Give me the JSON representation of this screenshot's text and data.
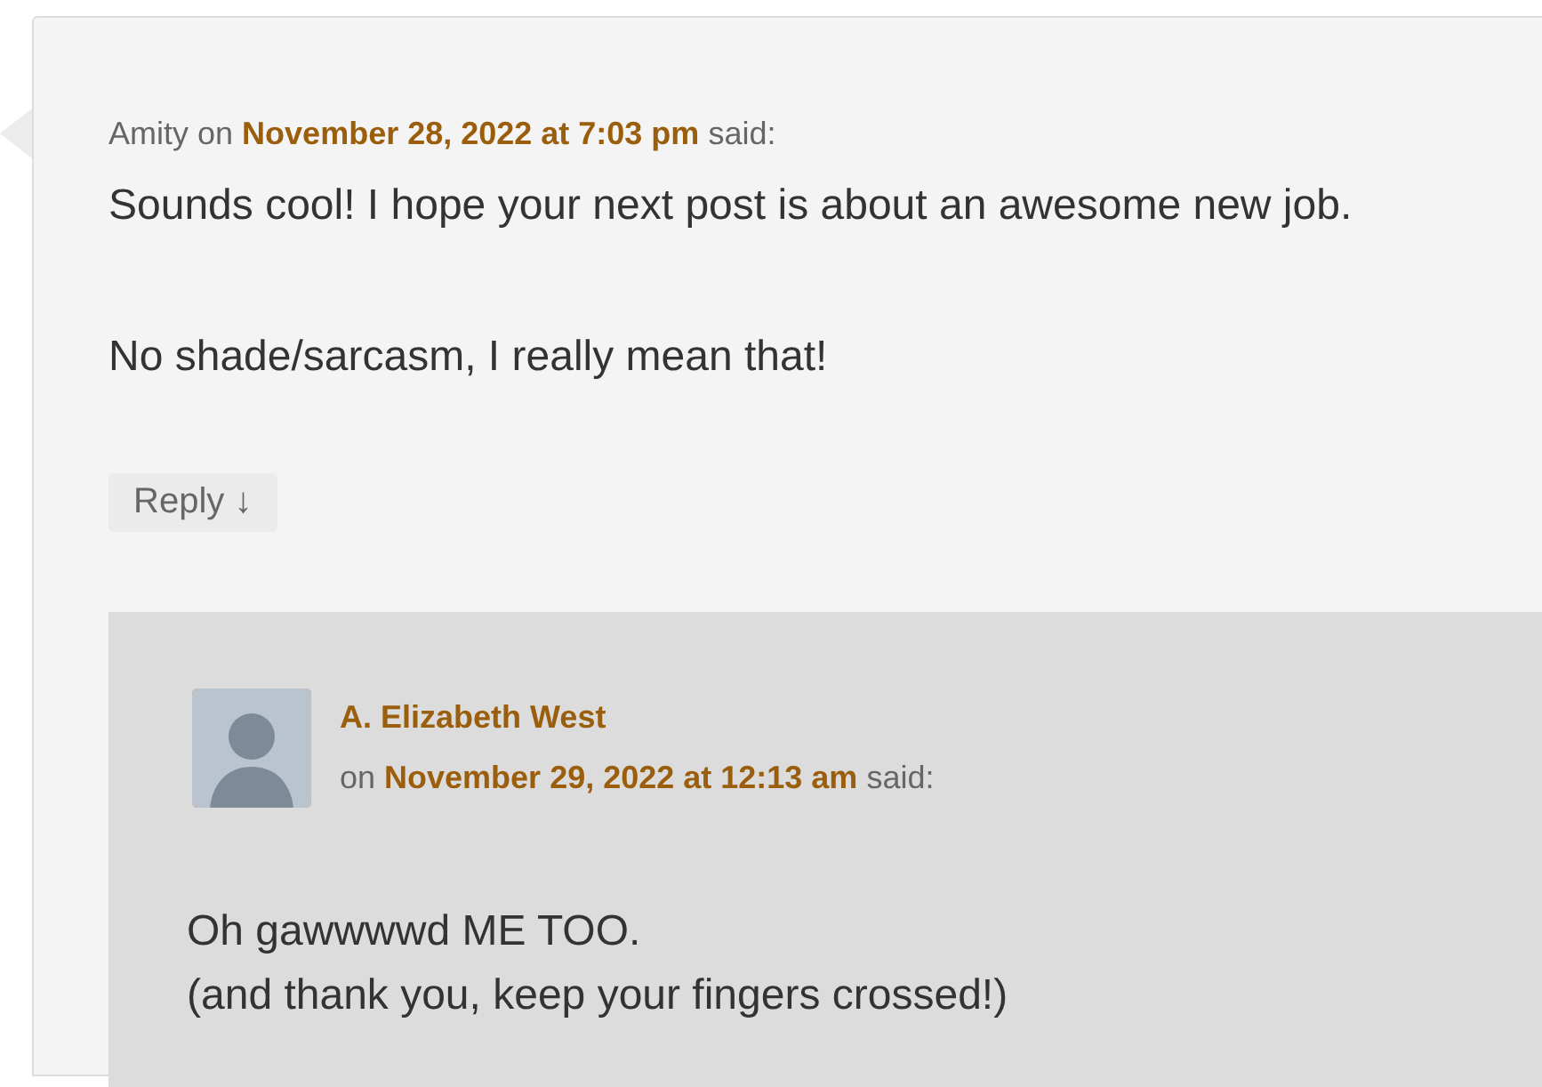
{
  "comments": [
    {
      "kind": "top",
      "author": "Amity",
      "author_link": false,
      "connector": "on",
      "date": "November 28, 2022 at 7:03 pm",
      "said": "said:",
      "paragraphs": [
        {
          "lines": [
            "Sounds cool! I hope your next post is about an awesome new job."
          ]
        },
        {
          "lines": [
            "No shade/sarcasm, I really mean that!"
          ]
        }
      ],
      "reply_button": "Reply ↓",
      "replies": [
        {
          "kind": "nested",
          "author": "A. Elizabeth West",
          "author_link": true,
          "connector": "on",
          "date": "November 29, 2022 at 12:13 am",
          "said": "said:",
          "paragraphs": [
            {
              "lines": [
                "Oh gawwwwd ME TOO.",
                "(and thank you, keep your fingers crossed!)"
              ]
            }
          ]
        }
      ]
    }
  ]
}
